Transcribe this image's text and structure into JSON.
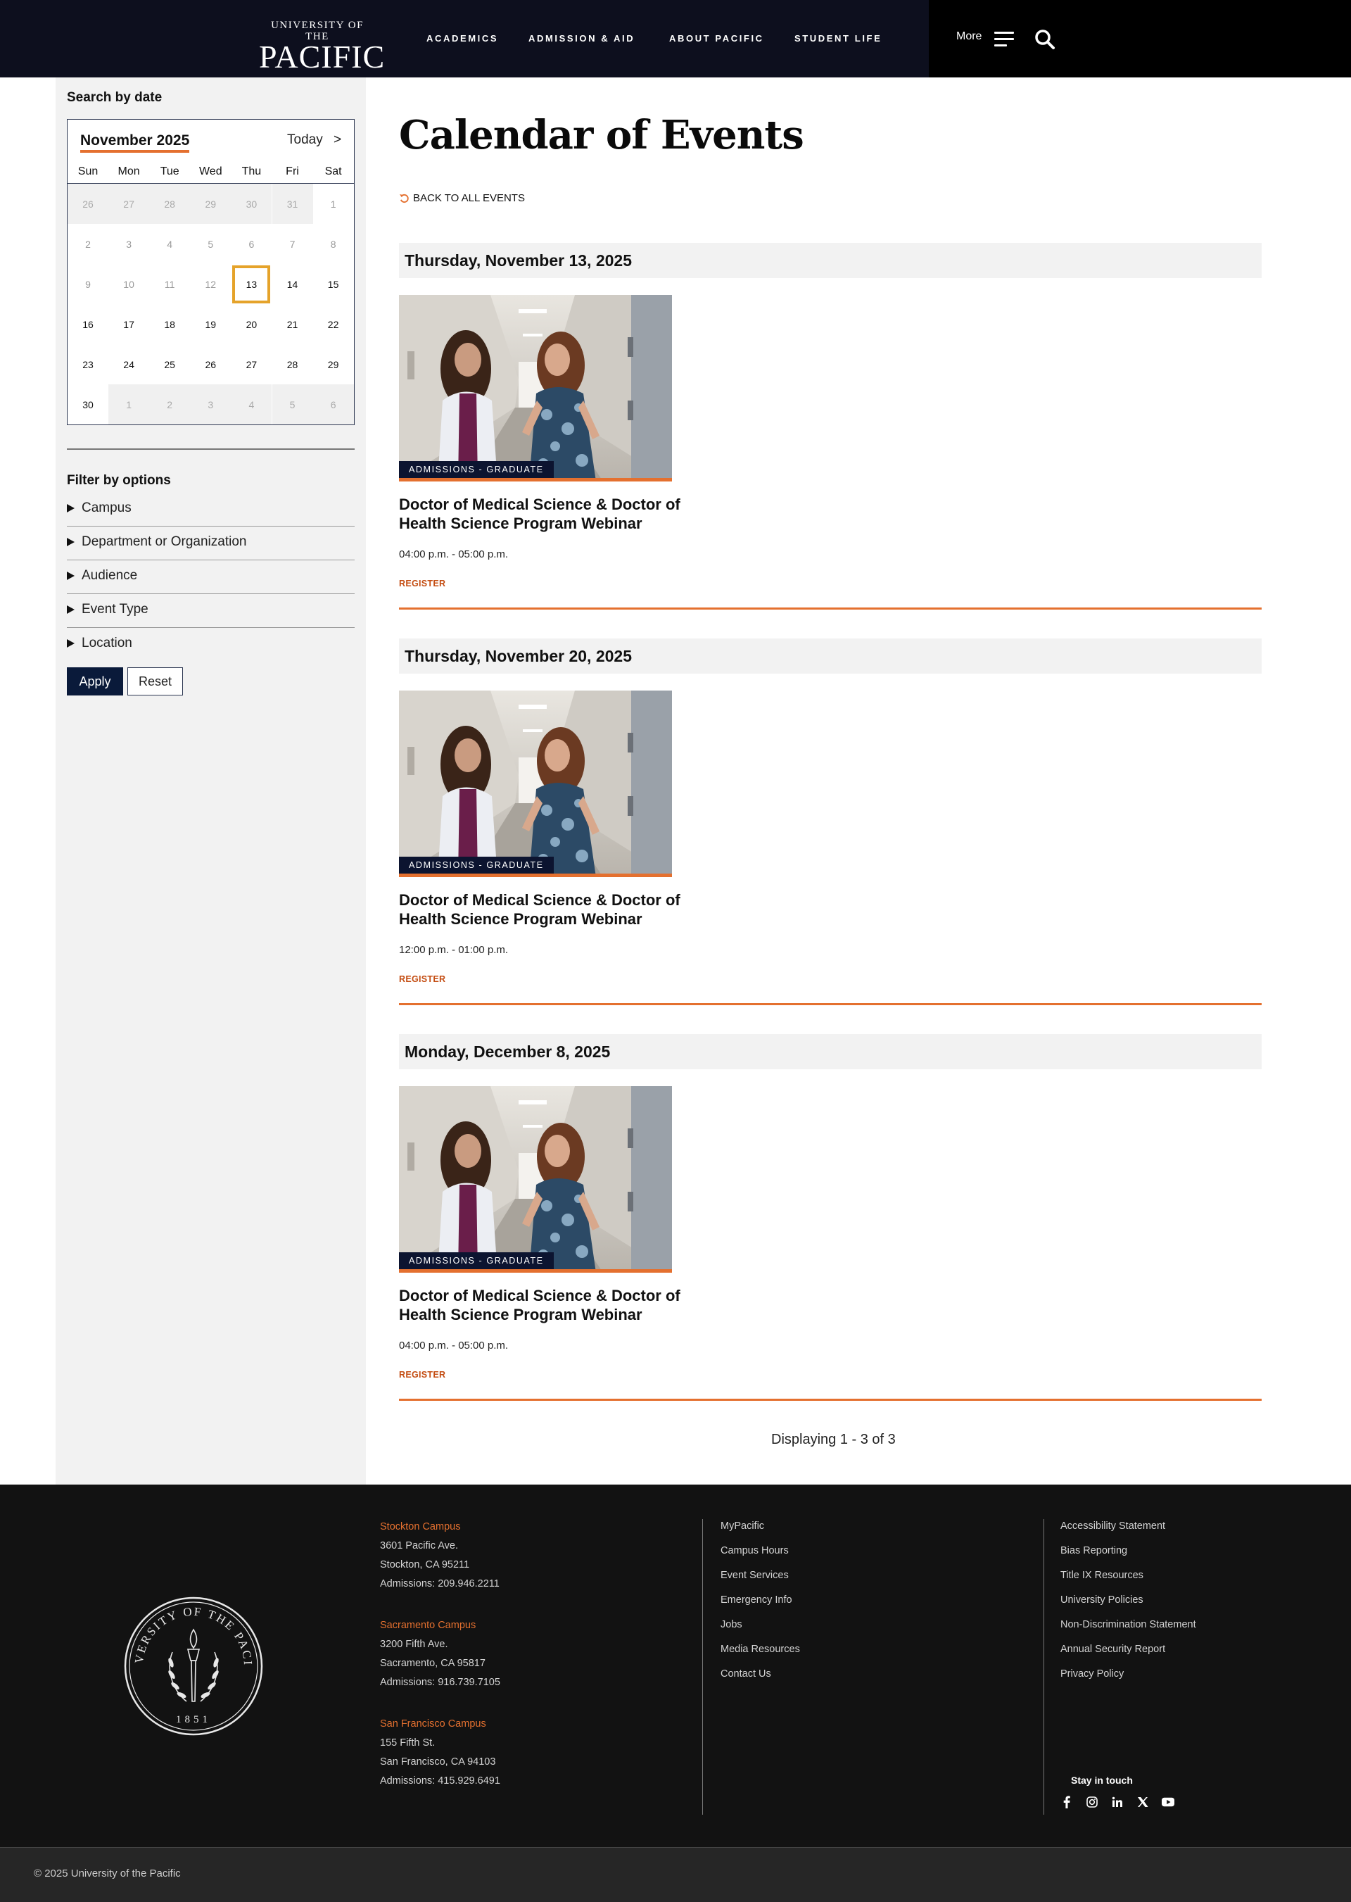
{
  "header": {
    "logo_line1": "UNIVERSITY OF THE",
    "logo_line2": "PACIFIC",
    "nav": [
      "ACADEMICS",
      "ADMISSION & AID",
      "ABOUT PACIFIC",
      "STUDENT LIFE"
    ],
    "more_label": "More",
    "menu_icon": "hamburger-menu-icon",
    "search_icon": "magnifier-search-icon"
  },
  "sidebar": {
    "search_heading": "Search by date",
    "calendar": {
      "month_label": "November 2025",
      "today_label": "Today",
      "next_label": ">",
      "weekdays": [
        "Sun",
        "Mon",
        "Tue",
        "Wed",
        "Thu",
        "Fri",
        "Sat"
      ],
      "weeks": [
        [
          "26",
          "27",
          "28",
          "29",
          "30",
          "31",
          "1"
        ],
        [
          "2",
          "3",
          "4",
          "5",
          "6",
          "7",
          "8"
        ],
        [
          "9",
          "10",
          "11",
          "12",
          "13",
          "14",
          "15"
        ],
        [
          "16",
          "17",
          "18",
          "19",
          "20",
          "21",
          "22"
        ],
        [
          "23",
          "24",
          "25",
          "26",
          "27",
          "28",
          "29"
        ],
        [
          "30",
          "1",
          "2",
          "3",
          "4",
          "5",
          "6"
        ]
      ],
      "selected_day": "13"
    },
    "filter_heading": "Filter by options",
    "filters": [
      "Campus",
      "Department or Organization",
      "Audience",
      "Event Type",
      "Location"
    ],
    "apply_label": "Apply",
    "reset_label": "Reset"
  },
  "main": {
    "page_title": "Calendar of Events",
    "back_link": "BACK TO ALL EVENTS",
    "events": [
      {
        "date": "Thursday, November 13, 2025",
        "tag": "ADMISSIONS - GRADUATE",
        "title": "Doctor of Medical Science & Doctor of Health Science Program Webinar",
        "time": "04:00 p.m. - 05:00 p.m.",
        "register": "REGISTER"
      },
      {
        "date": "Thursday, November 20, 2025",
        "tag": "ADMISSIONS - GRADUATE",
        "title": "Doctor of Medical Science & Doctor of Health Science Program Webinar",
        "time": "12:00 p.m. - 01:00 p.m.",
        "register": "REGISTER"
      },
      {
        "date": "Monday, December 8, 2025",
        "tag": "ADMISSIONS - GRADUATE",
        "title": "Doctor of Medical Science & Doctor of Health Science Program Webinar",
        "time": "04:00 p.m. - 05:00 p.m.",
        "register": "REGISTER"
      }
    ],
    "displaying": "Displaying 1 - 3 of 3"
  },
  "footer": {
    "seal_text_top": "UNIVERSITY OF THE PACIFIC",
    "seal_year": "1851",
    "campuses": [
      {
        "name": "Stockton Campus",
        "address1": "3601 Pacific Ave.",
        "address2": "Stockton, CA 95211",
        "phone": "Admissions: 209.946.2211"
      },
      {
        "name": "Sacramento Campus",
        "address1": "3200 Fifth Ave.",
        "address2": "Sacramento, CA 95817",
        "phone": "Admissions: 916.739.7105"
      },
      {
        "name": "San Francisco Campus",
        "address1": "155 Fifth St.",
        "address2": "San Francisco, CA 94103",
        "phone": "Admissions: 415.929.6491"
      }
    ],
    "links_col1": [
      "MyPacific",
      "Campus Hours",
      "Event Services",
      "Emergency Info",
      "Jobs",
      "Media Resources",
      "Contact Us"
    ],
    "links_col2": [
      "Accessibility Statement",
      "Bias Reporting",
      "Title IX Resources",
      "University Policies",
      "Non-Discrimination Statement",
      "Annual Security Report",
      "Privacy Policy"
    ],
    "stay_in_touch": "Stay in touch",
    "social_icons": [
      "facebook-icon",
      "instagram-icon",
      "linkedin-icon",
      "x-icon",
      "youtube-icon"
    ],
    "copyright": "© 2025 University of the Pacific"
  },
  "colors": {
    "accent_orange": "#e4702f",
    "navy": "#0a1a3a",
    "header_bg": "#0d0f1e",
    "footer_bg": "#121212",
    "highlight_gold": "#e5a32a"
  }
}
